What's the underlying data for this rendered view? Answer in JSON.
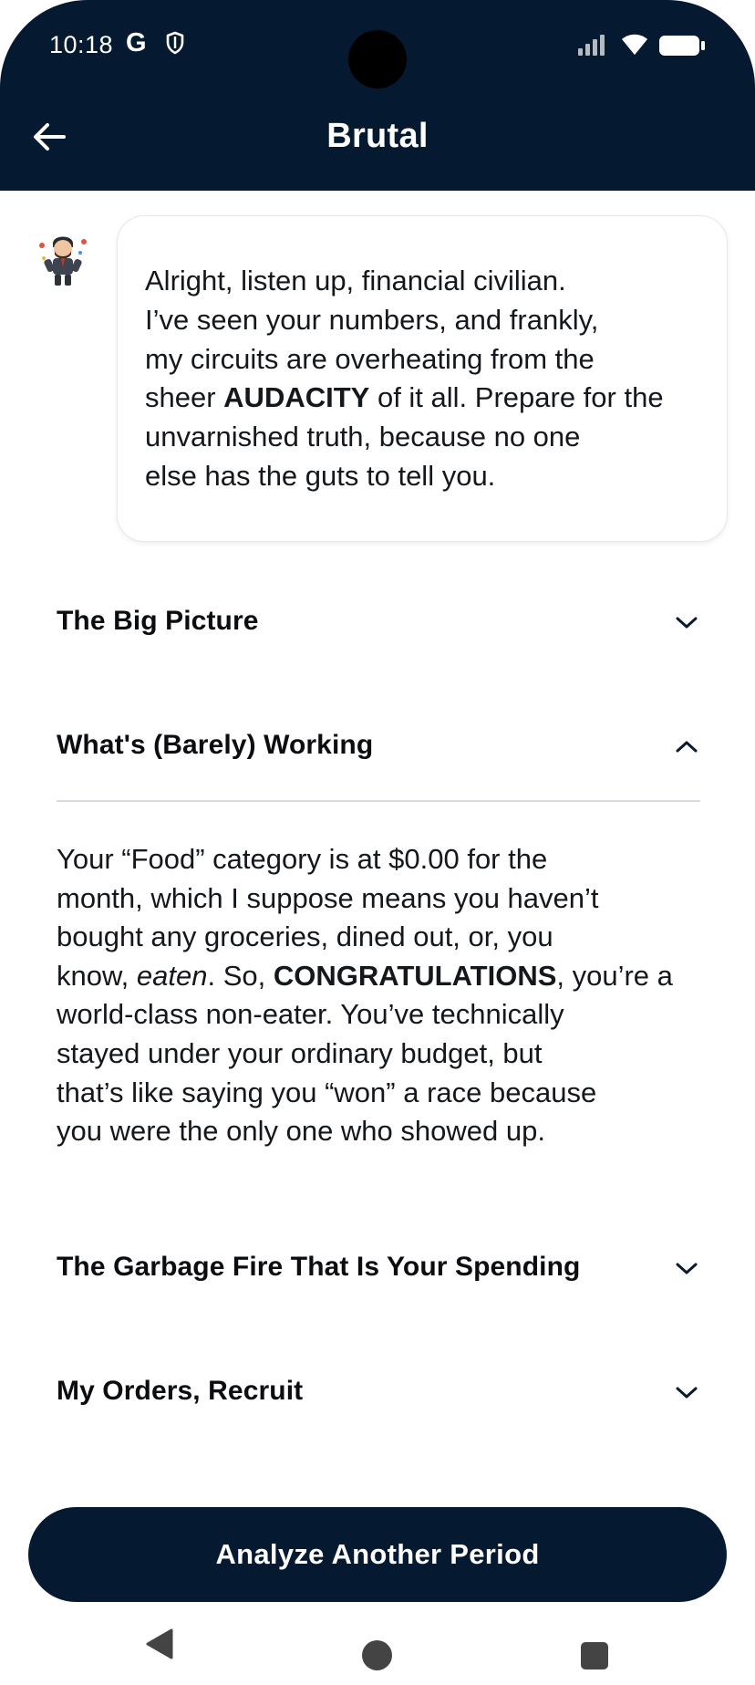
{
  "status_bar": {
    "time": "10:18",
    "g_label": "G",
    "icons": [
      "shield-icon",
      "signal-icon",
      "wifi-icon",
      "battery-icon"
    ]
  },
  "app_bar": {
    "title": "Brutal",
    "back_icon": "arrow-left-icon"
  },
  "message": {
    "line_1": "Alright, listen up, financial civilian.",
    "line_2": "I’ve seen your numbers, and frankly,",
    "line_3": "my circuits are overheating from the",
    "line_4_pre": "sheer ",
    "line_4_bold": "AUDACITY",
    "line_4_post": " of it all. Prepare for the",
    "line_5": "unvarnished truth, because no one",
    "line_6": "else has the guts to tell you."
  },
  "sections": [
    {
      "title": "The Big Picture",
      "expanded": false
    },
    {
      "title": "What's (Barely) Working",
      "expanded": true,
      "body": {
        "line_1": "Your “Food” category is at $0.00 for the",
        "line_2": "month, which I suppose means you haven’t",
        "line_3": "bought any groceries, dined out, or, you",
        "line_4_pre": "know, ",
        "line_4_italic": "eaten",
        "line_4_mid": ". So, ",
        "line_4_bold": "CONGRATULATIONS",
        "line_4_post": ", you’re a",
        "line_5": "world-class non-eater. You’ve technically",
        "line_6": "stayed under your ordinary budget, but",
        "line_7": "that’s like saying you “won” a race because",
        "line_8": "you were the only one who showed up."
      }
    },
    {
      "title": "The Garbage Fire That Is Your Spending",
      "expanded": false
    },
    {
      "title": "My Orders, Recruit",
      "expanded": false
    }
  ],
  "primary_button": {
    "label": "Analyze Another Period"
  },
  "colors": {
    "header_bg": "#051a30",
    "button_bg": "#051a30",
    "text": "#14171c",
    "divider": "#d9dce0"
  }
}
